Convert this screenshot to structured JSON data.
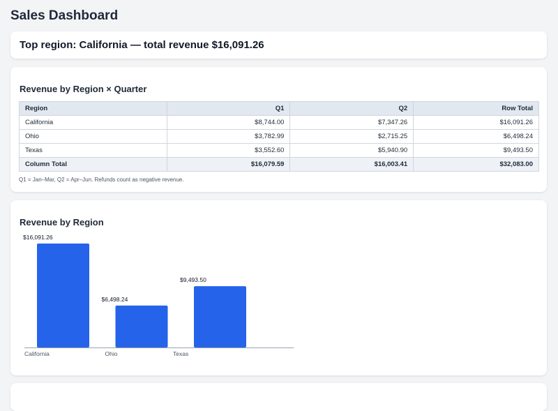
{
  "page": {
    "title": "Sales Dashboard"
  },
  "summary": {
    "text": "Top region: California — total revenue $16,091.26"
  },
  "pivot": {
    "title": "Revenue by Region × Quarter",
    "headers": [
      "Region",
      "Q1",
      "Q2",
      "Row Total"
    ],
    "rows": [
      [
        "California",
        "$8,744.00",
        "$7,347.26",
        "$16,091.26"
      ],
      [
        "Ohio",
        "$3,782.99",
        "$2,715.25",
        "$6,498.24"
      ],
      [
        "Texas",
        "$3,552.60",
        "$5,940.90",
        "$9,493.50"
      ]
    ],
    "totals": [
      "Column Total",
      "$16,079.59",
      "$16,003.41",
      "$32,083.00"
    ],
    "note": "Q1 = Jan–Mar, Q2 = Apr–Jun. Refunds count as negative revenue."
  },
  "chart_section": {
    "title": "Revenue by Region"
  },
  "chart_data": {
    "type": "bar",
    "title": "Revenue by Region",
    "categories": [
      "California",
      "Ohio",
      "Texas"
    ],
    "values": [
      16091.26,
      6498.24,
      9493.5
    ],
    "value_labels": [
      "$16,091.26",
      "$6,498.24",
      "$9,493.50"
    ],
    "xlabel": "",
    "ylabel": "",
    "ylim": [
      0,
      16091.26
    ],
    "grid": false,
    "bar_color": "#2563eb",
    "axis_color": "#9ca3af"
  }
}
